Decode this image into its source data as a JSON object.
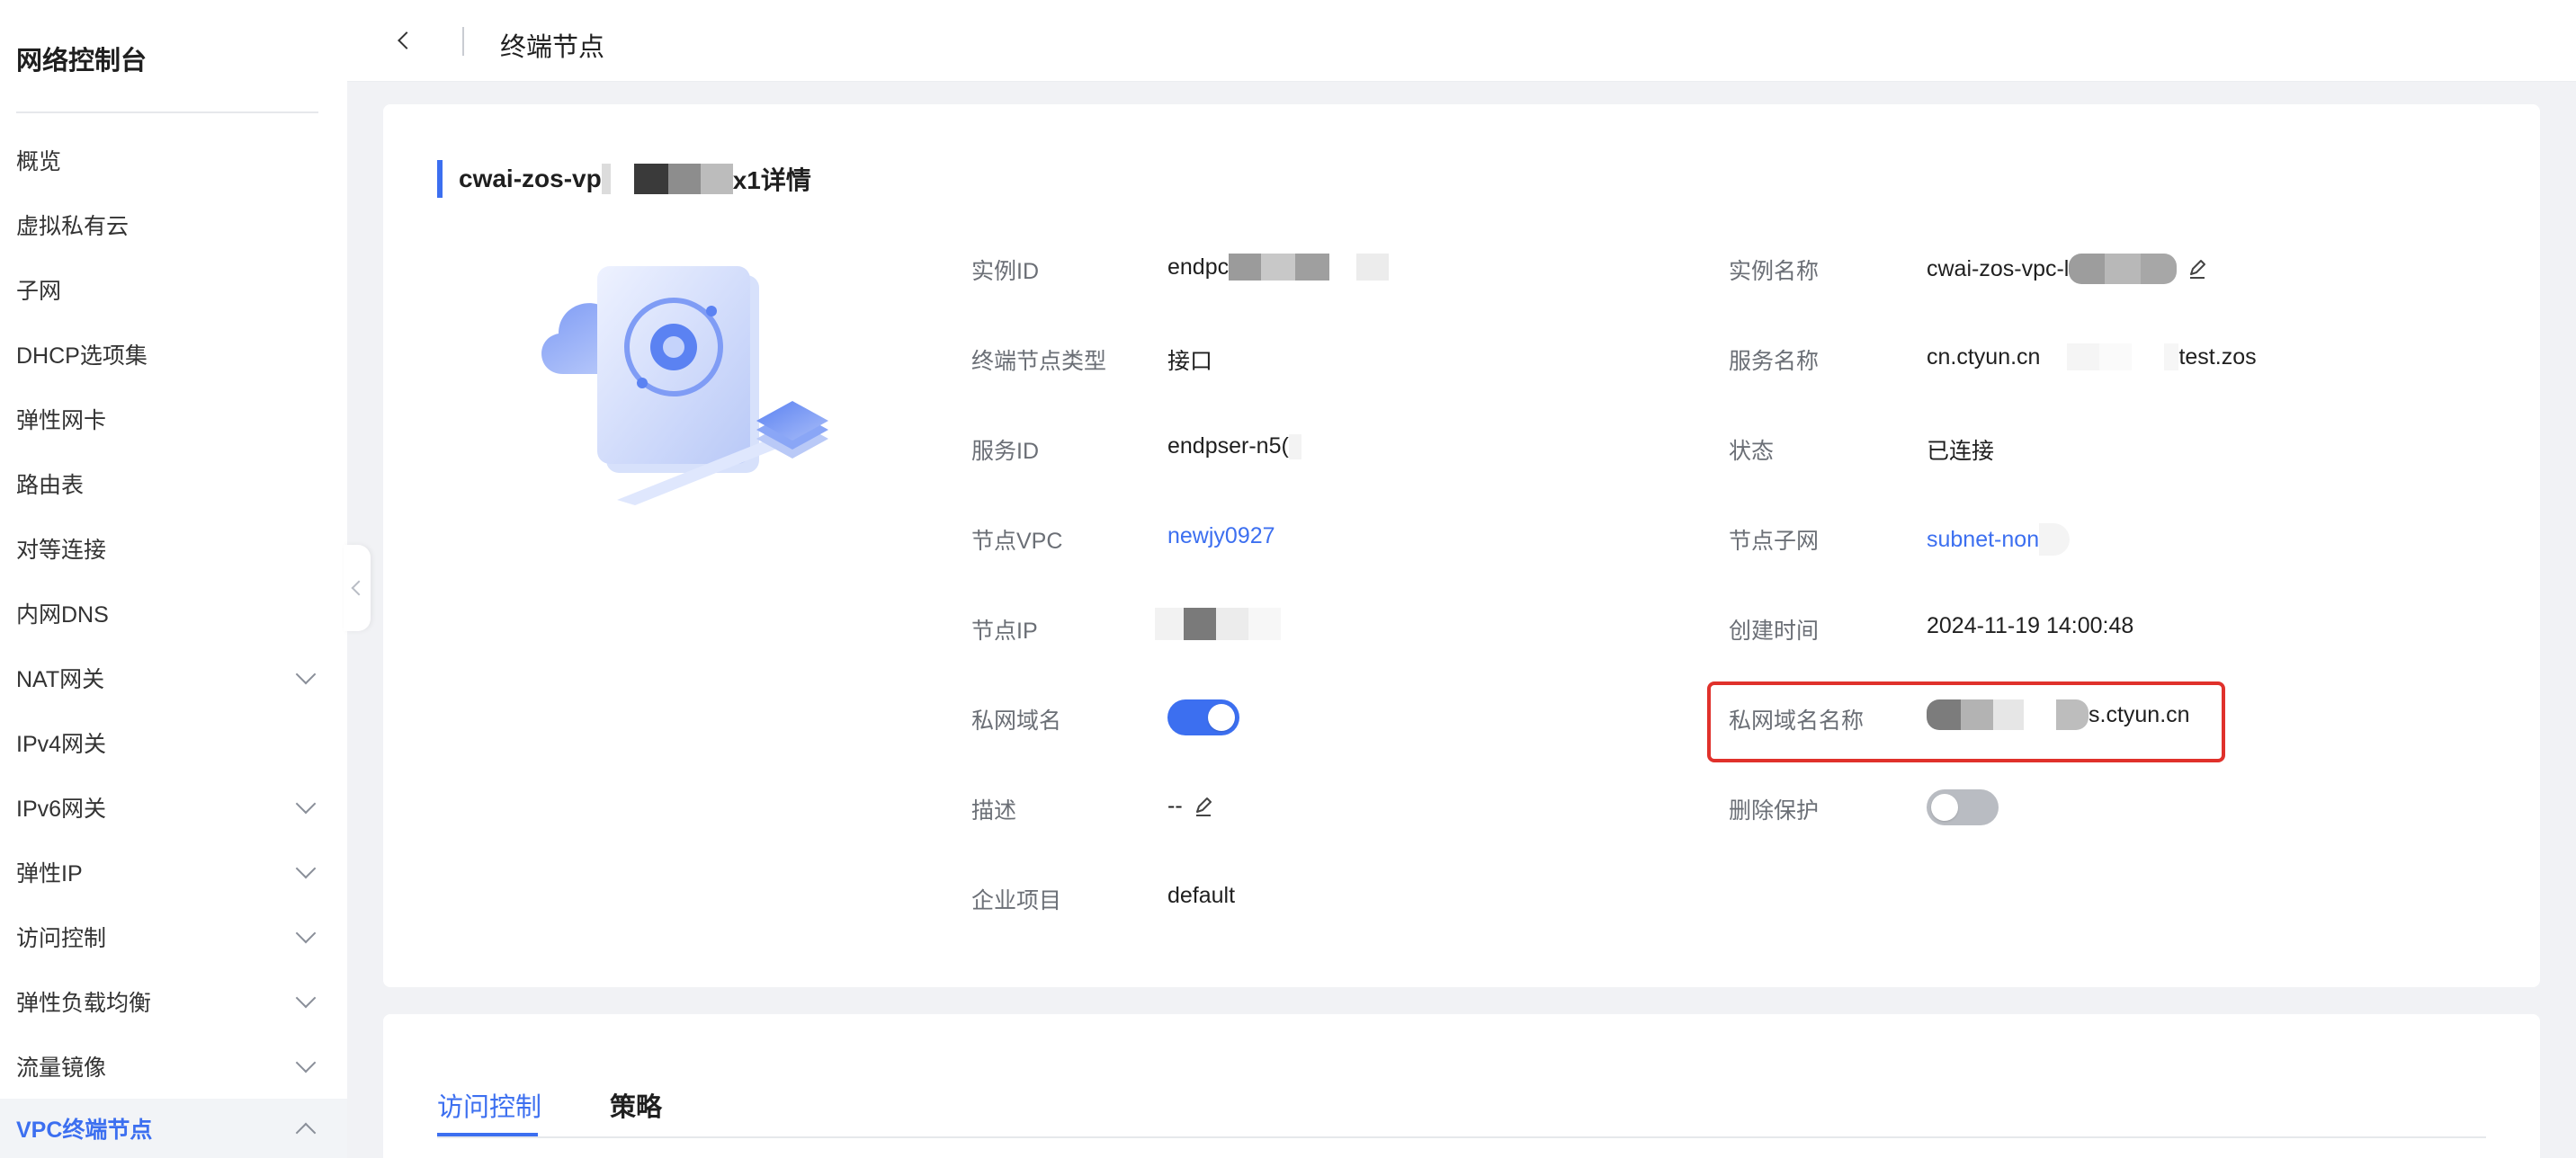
{
  "sidebar": {
    "title": "网络控制台",
    "items": [
      {
        "label": "概览",
        "has_chevron": false
      },
      {
        "label": "虚拟私有云",
        "has_chevron": false
      },
      {
        "label": "子网",
        "has_chevron": false
      },
      {
        "label": "DHCP选项集",
        "has_chevron": false
      },
      {
        "label": "弹性网卡",
        "has_chevron": false
      },
      {
        "label": "路由表",
        "has_chevron": false
      },
      {
        "label": "对等连接",
        "has_chevron": false
      },
      {
        "label": "内网DNS",
        "has_chevron": false
      },
      {
        "label": "NAT网关",
        "has_chevron": true
      },
      {
        "label": "IPv4网关",
        "has_chevron": false
      },
      {
        "label": "IPv6网关",
        "has_chevron": true
      },
      {
        "label": "弹性IP",
        "has_chevron": true
      },
      {
        "label": "访问控制",
        "has_chevron": true
      },
      {
        "label": "弹性负载均衡",
        "has_chevron": true
      },
      {
        "label": "流量镜像",
        "has_chevron": true
      },
      {
        "label": "VPC终端节点",
        "has_chevron": true,
        "active": true
      }
    ]
  },
  "header": {
    "title": "终端节点"
  },
  "detail": {
    "title_prefix": "cwai-zos-vp",
    "title_suffix": "x1详情",
    "fields": {
      "instance_id": {
        "label": "实例ID",
        "value": "endpc"
      },
      "instance_name": {
        "label": "实例名称",
        "value": "cwai-zos-vpc-l"
      },
      "endpoint_type": {
        "label": "终端节点类型",
        "value": "接口"
      },
      "service_name": {
        "label": "服务名称",
        "value_prefix": "cn.ctyun.cn",
        "value_suffix": "test.zos"
      },
      "service_id": {
        "label": "服务ID",
        "value": "endpser-n5("
      },
      "status": {
        "label": "状态",
        "value": "已连接"
      },
      "node_vpc": {
        "label": "节点VPC",
        "value": "newjy0927"
      },
      "node_subnet": {
        "label": "节点子网",
        "value": "subnet-non"
      },
      "node_ip": {
        "label": "节点IP",
        "value": ""
      },
      "created_at": {
        "label": "创建时间",
        "value": "2024-11-19 14:00:48"
      },
      "private_dns": {
        "label": "私网域名",
        "enabled": true
      },
      "private_dns_name": {
        "label": "私网域名名称",
        "value": "s.ctyun.cn"
      },
      "description": {
        "label": "描述",
        "value": "--"
      },
      "delete_protection": {
        "label": "删除保护",
        "enabled": false
      },
      "enterprise_project": {
        "label": "企业项目",
        "value": "default"
      }
    }
  },
  "tabs": [
    {
      "label": "访问控制",
      "active": true
    },
    {
      "label": "策略",
      "active": false
    }
  ],
  "colors": {
    "accent": "#3c6ff0",
    "highlight": "#e0312b",
    "toggle_off": "#b9bcc2"
  },
  "icons": [
    "chevron-left-icon",
    "chevron-down-icon",
    "chevron-up-icon",
    "edit-icon",
    "collapse-arrow-icon"
  ]
}
